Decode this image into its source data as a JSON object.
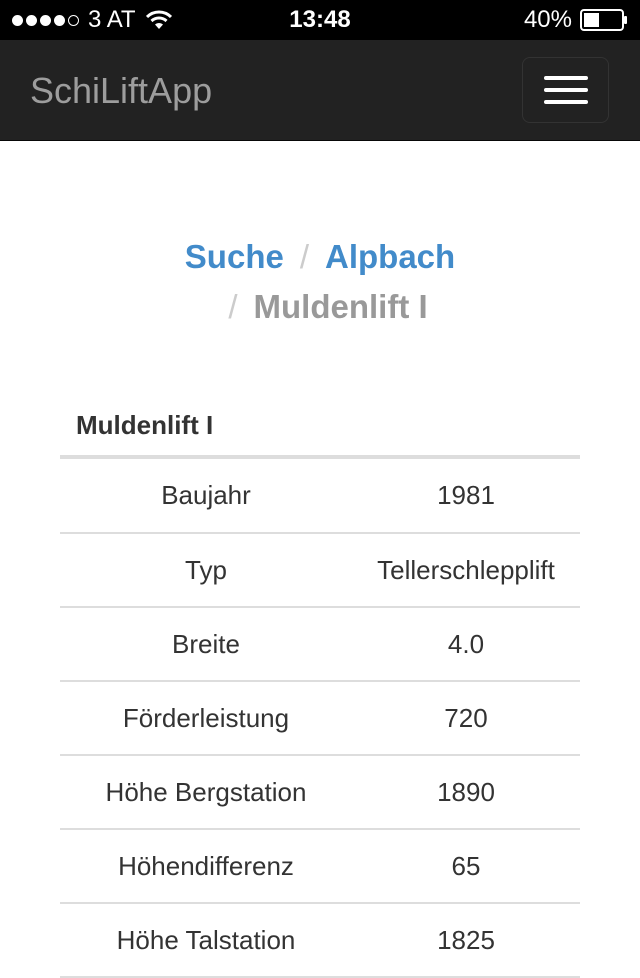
{
  "status_bar": {
    "carrier": "3 AT",
    "time": "13:48",
    "battery": "40%"
  },
  "navbar": {
    "brand": "SchiLiftApp",
    "toggle_icon": "hamburger-menu-icon"
  },
  "breadcrumb": {
    "items": [
      "Suche",
      "Alpbach"
    ],
    "active": "Muldenlift I",
    "separator": "/"
  },
  "detail_table": {
    "title": "Muldenlift I",
    "rows": [
      {
        "label": "Baujahr",
        "value": "1981"
      },
      {
        "label": "Typ",
        "value": "Tellerschlepplift"
      },
      {
        "label": "Breite",
        "value": "4.0"
      },
      {
        "label": "Förderleistung",
        "value": "720"
      },
      {
        "label": "Höhe Bergstation",
        "value": "1890"
      },
      {
        "label": "Höhendifferenz",
        "value": "65"
      },
      {
        "label": "Höhe Talstation",
        "value": "1825"
      }
    ]
  },
  "colors": {
    "navbar_bg": "#222222",
    "link": "#428bca",
    "active_crumb": "#999999"
  }
}
